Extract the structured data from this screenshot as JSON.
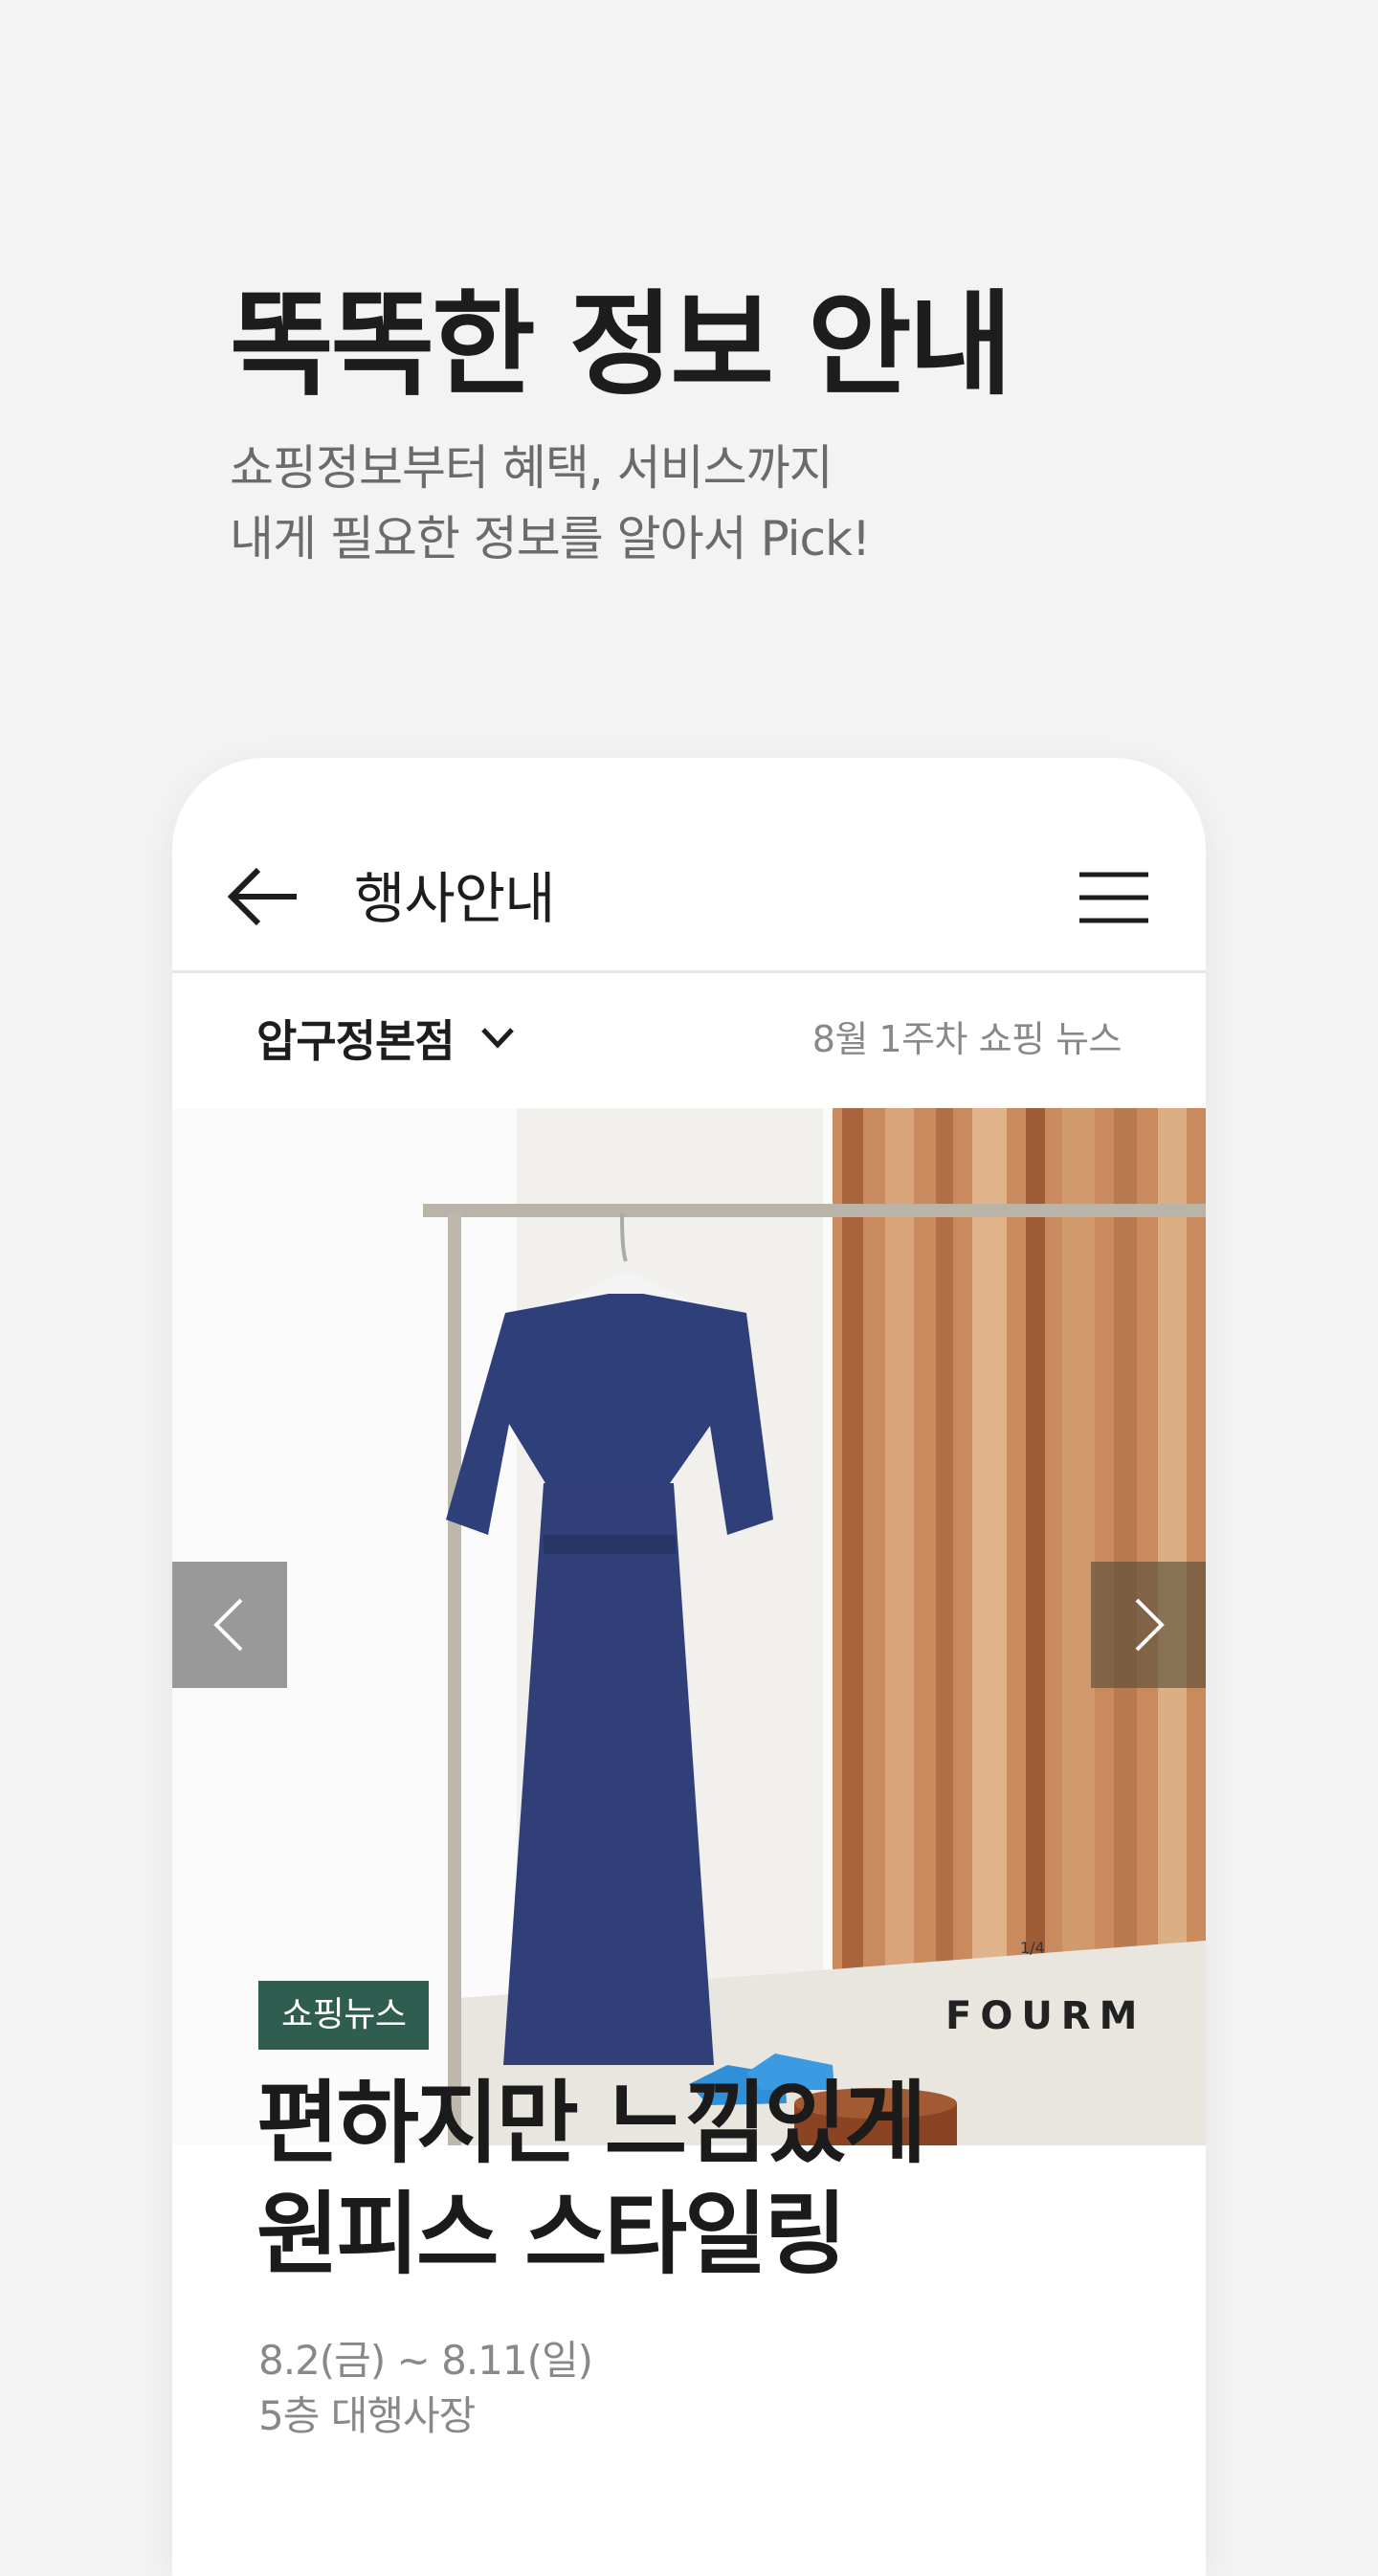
{
  "hero": {
    "title": "똑똑한 정보 안내",
    "subtitle_line1": "쇼핑정보부터 혜택, 서비스까지",
    "subtitle_line2": "내게 필요한 정보를 알아서 Pick!"
  },
  "appbar": {
    "back_icon": "arrow-left-icon",
    "title": "행사안내",
    "menu_icon": "hamburger-menu-icon"
  },
  "subbar": {
    "store": "압구정본점",
    "store_icon": "chevron-down-icon",
    "week": "8월  1주차 쇼핑 뉴스"
  },
  "banner": {
    "prev_icon": "chevron-left-icon",
    "next_icon": "chevron-right-icon",
    "brand": "FOURM",
    "counter": "1/4"
  },
  "article": {
    "badge": "쇼핑뉴스",
    "headline_line1": "편하지만 느낌있게",
    "headline_line2": "원피스 스타일링",
    "date": "8.2(금) ~ 8.11(일)",
    "location": "5층 대행사장"
  },
  "colors": {
    "background": "#f3f3f3",
    "badge": "#2f5d4f",
    "dress": "#2f3f7a",
    "shoes": "#2f8fd8",
    "wood": "#b7774d"
  }
}
